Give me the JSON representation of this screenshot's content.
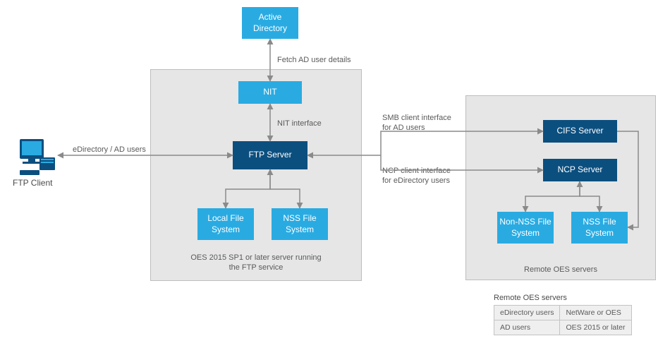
{
  "nodes": {
    "activeDirectory": "Active Directory",
    "nit": "NIT",
    "ftpServer": "FTP Server",
    "localFS": "Local File System",
    "nssFS1": "NSS File System",
    "cifsServer": "CIFS Server",
    "ncpServer": "NCP Server",
    "nonNssFS": "Non-NSS File System",
    "nssFS2": "NSS File System"
  },
  "labels": {
    "fetchAD": "Fetch AD user details",
    "nitInterface": "NIT interface",
    "edirAD": "eDirectory / AD users",
    "oesCaption": "OES 2015 SP1 or later server running\nthe FTP service",
    "remoteCaption": "Remote OES servers",
    "smbClient": "SMB client interface\nfor AD users",
    "ncpClient": "NCP client interface\nfor eDirectory users",
    "ftpClient": "FTP Client"
  },
  "table": {
    "title": "Remote OES servers",
    "rows": [
      {
        "c1": "eDirectory users",
        "c2": "NetWare or OES"
      },
      {
        "c1": "AD users",
        "c2": "OES 2015 or later"
      }
    ]
  }
}
